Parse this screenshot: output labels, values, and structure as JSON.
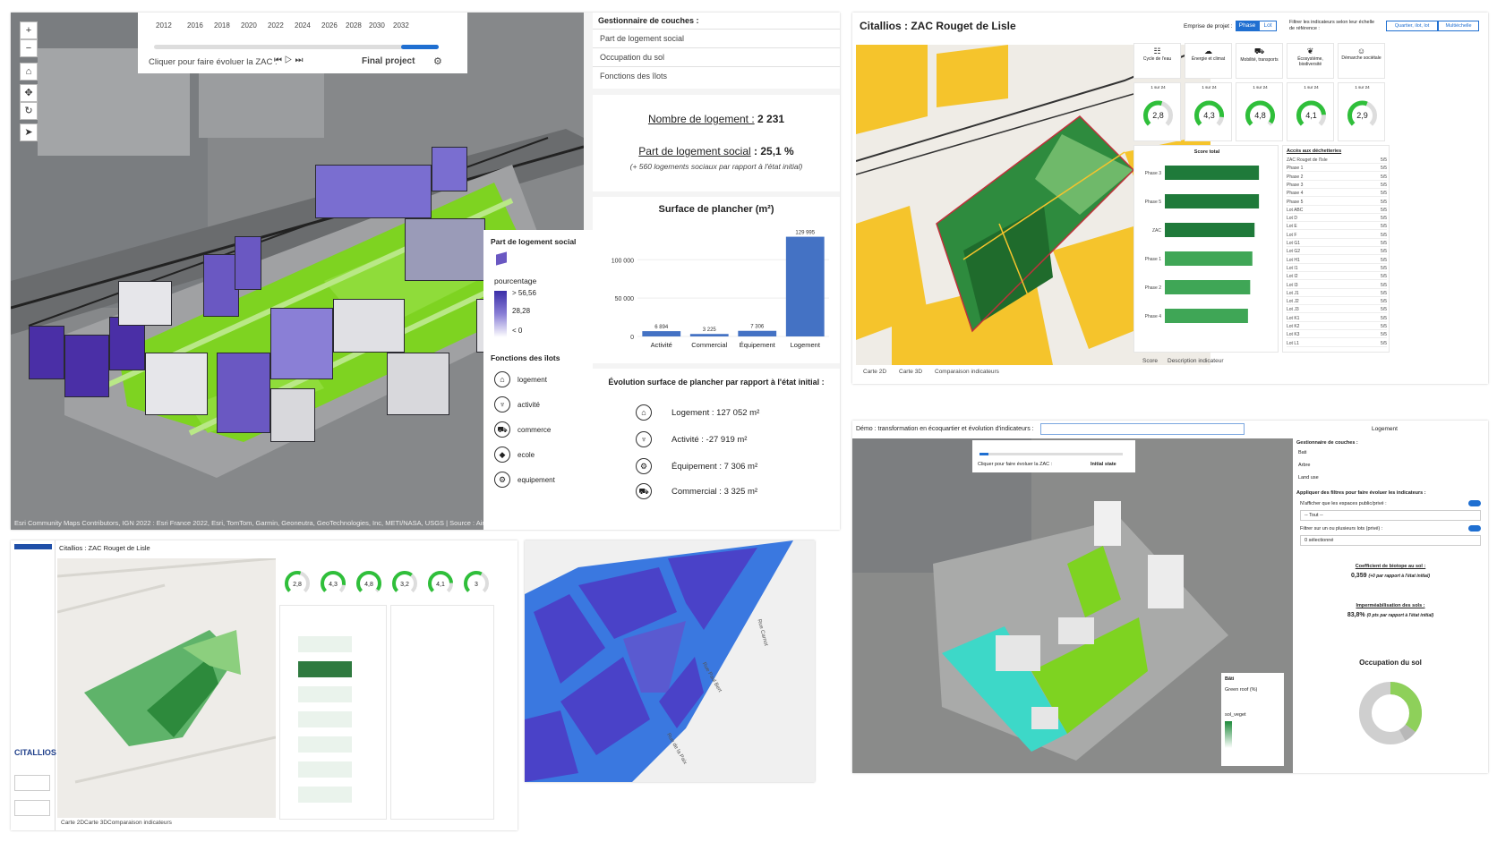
{
  "p1": {
    "timeline": {
      "years": [
        "2012",
        "2016",
        "2018",
        "2020",
        "2022",
        "2024",
        "2026",
        "2028",
        "2030",
        "2032"
      ],
      "caption": "Cliquer pour faire évoluer la ZAC :",
      "final_label": "Final project",
      "progress": 1.0
    },
    "layers": {
      "title": "Gestionnaire de couches :",
      "items": [
        "Part de logement social",
        "Occupation du sol",
        "Fonctions des îlots"
      ]
    },
    "kpi": {
      "nb_label": "Nombre de logement :",
      "nb_value": "2 231",
      "part_label": "Part de logement social",
      "part_value": ": 25,1 %",
      "note": "(+ 560 logements sociaux par rapport à l'état initial)"
    },
    "legend": {
      "title": "Part de logement social",
      "unit": "pourcentage",
      "g1": "> 56,56",
      "g2": "28,28",
      "g3": "< 0",
      "fonctions_title": "Fonctions des îlots",
      "fonctions": [
        "logement",
        "activité",
        "commerce",
        "ecole",
        "equipement"
      ]
    },
    "evolution": {
      "title": "Évolution surface de plancher par rapport à l'état initial :",
      "rows": [
        "Logement : 127 052 m²",
        "Activité : -27 919  m²",
        "Équipement : 7 306  m²",
        "Commercial : 3 325 m²"
      ]
    },
    "attribution": "Esri Community Maps Contributors, IGN 2022 : Esri France 2022, Esri, TomTom, Garmin, Geoneutra, GeoTechnologies, Inc, METI/NASA, USGS | Source : Airbus,USG..     Powered by Esri"
  },
  "chart_data": {
    "type": "bar",
    "title": "Surface de plancher (m²)",
    "categories": [
      "Activité",
      "Commercial",
      "Équipement",
      "Logement"
    ],
    "values": [
      6894,
      3225,
      7306,
      129995
    ],
    "value_labels": [
      "6 894",
      "3 225",
      "7 306",
      "129 995"
    ],
    "yticks": [
      "0",
      "50 000",
      "100 000"
    ],
    "ylim": [
      0,
      140000
    ],
    "color": "#4472c4"
  },
  "p2": {
    "title": "Citallios : ZAC Rouget de Lisle",
    "emprise_label": "Emprise de projet :",
    "toggle": [
      "Phase",
      "Lot"
    ],
    "filter_label": "Filtrer les indicateurs selon leur échelle de référence :",
    "filter_opts": [
      "Quartier, ilot, lot",
      "Multiéchelle"
    ],
    "themes": [
      "Cycle de l'eau",
      "Énergie et climat",
      "Mobilité, transports",
      "Écosystème, biodiversité",
      "Démarche sociétale"
    ],
    "gauge_pages": [
      "1 sur 24",
      "1 sur 24",
      "1 sur 24",
      "1 sur 24",
      "1 sur 24"
    ],
    "gauges": [
      2.8,
      4.3,
      4.8,
      4.1,
      2.9
    ],
    "gauge_labels": [
      "2,8",
      "4,3",
      "4,8",
      "4,1",
      "2,9"
    ],
    "score_title": "Score total",
    "score_rows": [
      "Phase 3",
      "Phase 5",
      "ZAC",
      "Phase 1",
      "Phase 2",
      "Phase 4"
    ],
    "score_values": [
      4.3,
      4.3,
      4.1,
      4.0,
      3.9,
      3.8
    ],
    "table_title": "Accès aux déchetteries",
    "table_rows": [
      "ZAC Rouget de l'Isle",
      "Phase 1",
      "Phase 2",
      "Phase 3",
      "Phase 4",
      "Phase 5",
      "Lot ABC",
      "Lot D",
      "Lot E",
      "Lot F",
      "Lot G1",
      "Lot G2",
      "Lot H1",
      "Lot I1",
      "Lot I2",
      "Lot I3",
      "Lot J1",
      "Lot J2",
      "Lot J3",
      "Lot K1",
      "Lot K2",
      "Lot K3",
      "Lot L1"
    ],
    "table_val": "5/5",
    "tabs": [
      "Carte 2D",
      "Carte 3D",
      "Comparaison indicateurs"
    ],
    "bottom_tabs": [
      "Score",
      "Description indicateur"
    ]
  },
  "p3": {
    "header": "Démo : transformation en écoquartier et évolution d'indicateurs :",
    "tab_right": "Logement",
    "layers_title": "Gestionnaire de couches :",
    "layers": [
      "Bati",
      "Arbre",
      "Land use"
    ],
    "filters_title": "Appliquer des filtres pour faire évoluer les indicateurs :",
    "filter1": "N'afficher que les espaces public/privé :",
    "filter1_value": "-- Tout --",
    "filter2": "Filtrer sur un ou plusieurs lots (privé) :",
    "filter2_value": "0 sélectionné",
    "cbs_title": "Coefficient de biotope au sol :",
    "cbs_value": "0,359",
    "cbs_note": "(+0 par rapport à l'état initial)",
    "imp_title": "Imperméabilisation des sols :",
    "imp_value": "83,8%",
    "imp_note": "(0 pts par rapport à l'état initial)",
    "occ_title": "Occupation du sol",
    "timeline_caption": "Cliquer pour faire évoluer la ZAC :",
    "timeline_state": "Initial state",
    "legend_title": "Bâti",
    "legend_sub": "Green roof (%)",
    "legend_sub2": "sol_veget"
  },
  "p4": {
    "title": "Citallios : ZAC Rouget de Lisle",
    "gauges": [
      "2,8",
      "4,3",
      "4,8",
      "3,2",
      "4,1",
      "3"
    ],
    "logo": "CITALLIOS",
    "tabs": [
      "Carte 2D",
      "Carte 3D",
      "Comparaison indicateurs"
    ]
  },
  "p5": {
    "streets": [
      "Rue Paul Bert",
      "Rue Carnot",
      "Rue de la Paix"
    ]
  }
}
